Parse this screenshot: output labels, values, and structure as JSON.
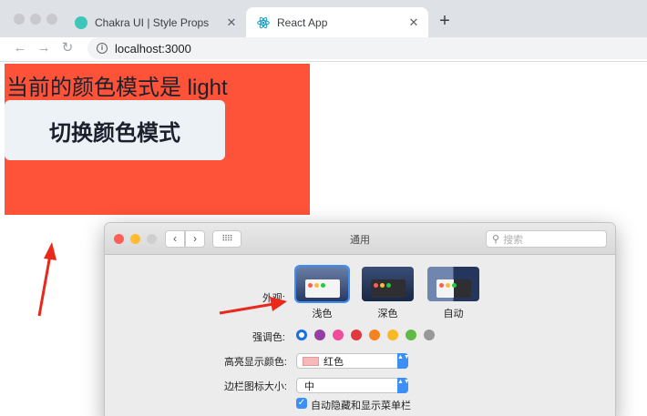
{
  "browser": {
    "tabs": [
      {
        "title": "Chakra UI | Style Props",
        "active": false,
        "favicon": "chakra-logo-icon"
      },
      {
        "title": "React App",
        "active": true,
        "favicon": "react-logo-icon"
      }
    ],
    "close_glyph": "✕",
    "new_tab_glyph": "+",
    "back_glyph": "←",
    "forward_glyph": "→",
    "reload_glyph": "↻",
    "info_glyph": "i",
    "url": "localhost:3000"
  },
  "page": {
    "mode_text": "当前的颜色模式是 light",
    "toggle_button": "切换颜色模式",
    "box_color": "#fe5338"
  },
  "prefs": {
    "title": "通用",
    "back_glyph": "‹",
    "forward_glyph": "›",
    "grid_glyph": "⠿⠿",
    "search_placeholder": "搜索",
    "search_glyph": "⚲",
    "appearance_label": "外观:",
    "appearance_options": [
      "浅色",
      "深色",
      "自动"
    ],
    "accent_label": "强调色:",
    "accent_colors": [
      "#1c6fe3",
      "#953fa5",
      "#f04c9a",
      "#e0383e",
      "#f58321",
      "#f9b925",
      "#62ba46",
      "#989898"
    ],
    "highlight_label": "高亮显示颜色:",
    "highlight_value": "红色",
    "sidebar_label": "边栏图标大小:",
    "sidebar_value": "中",
    "autohide_label": "自动隐藏和显示菜单栏",
    "check_glyph": "✓",
    "popup_arrows": "▲▼"
  }
}
